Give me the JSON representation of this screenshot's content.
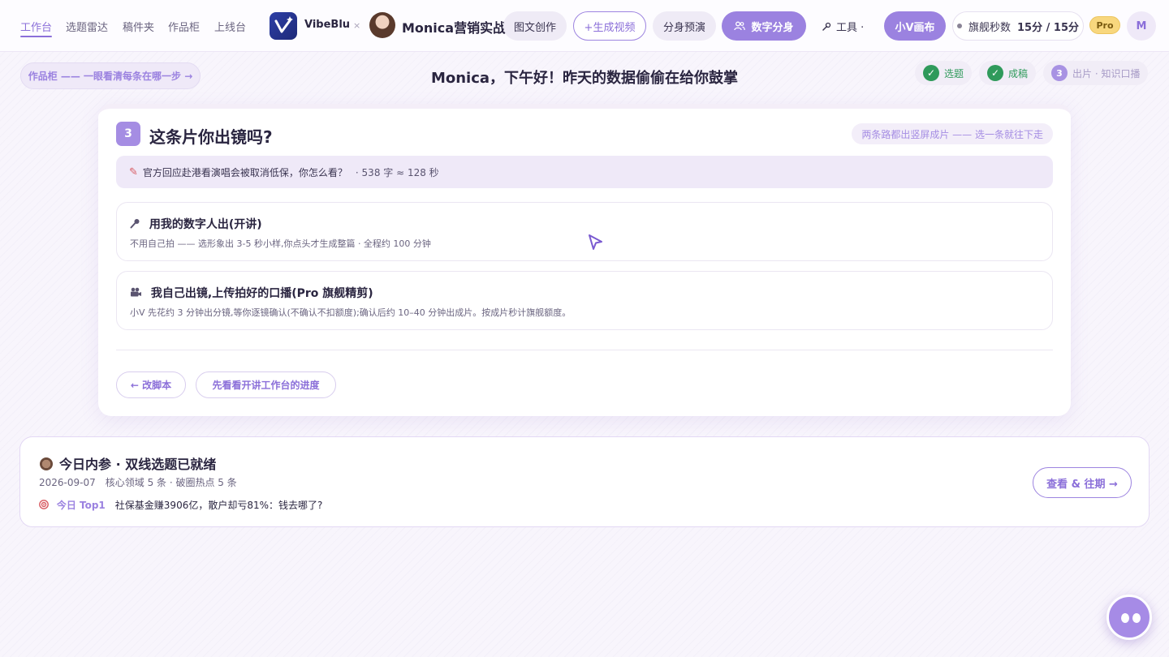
{
  "nav": {
    "links": [
      "工作台",
      "选题雷达",
      "稿件夹",
      "作品柜",
      "上线台"
    ],
    "brand": "VibeBlu",
    "separator": "×",
    "workspace": "Monica营销实战",
    "pills": {
      "image_text": "图文创作",
      "gen_video": "+生成视频",
      "preview": "分身预演",
      "digital_twin": "数字分身",
      "tools": "工具 ·",
      "canvas": "小V画布"
    },
    "credits": {
      "label": "旗舰秒数",
      "value": "15分 / 15分"
    },
    "pro": "Pro",
    "user_initial": "M"
  },
  "greeting": {
    "works_link": "作品柜 —— 一眼看清每条在哪一步 →",
    "text": "Monica，下午好！昨天的数据偷偷在给你鼓掌",
    "steps": [
      {
        "label": "选题",
        "mark": "✓"
      },
      {
        "label": "成稿",
        "mark": "✓"
      },
      {
        "label": "出片 · 知识口播",
        "mark": "3"
      }
    ]
  },
  "card": {
    "step": "3",
    "title": "这条片你出镜吗?",
    "hint": "两条路都出竖屏成片 —— 选一条就往下走",
    "script": {
      "title": "官方回应赴港看演唱会被取消低保，你怎么看？",
      "meta": "· 538 字 ≈ 128 秒"
    },
    "options": [
      {
        "icon": "microphone-icon",
        "title": "用我的数字人出(开讲)",
        "desc": "不用自己拍 —— 选形象出 3-5 秒小样,你点头才生成整篇 · 全程约 100 分钟"
      },
      {
        "icon": "camera-icon",
        "title": "我自己出镜,上传拍好的口播(Pro 旗舰精剪)",
        "desc": "小V 先花约 3 分钟出分镜,等你逐镜确认(不确认不扣额度);确认后约 10–40 分钟出成片。按成片秒计旗舰额度。"
      }
    ],
    "buttons": {
      "back": "← 改脚本",
      "progress": "先看看开讲工作台的进度"
    }
  },
  "brief": {
    "title": "今日内参 · 双线选题已就绪",
    "date": "2026-09-07",
    "meta": "核心领域 5 条 · 破圈热点 5 条",
    "top_label": "今日 Top1",
    "top_text": "社保基金赚3906亿，散户却亏81%：钱去哪了?",
    "view_button": "查看 & 往期 →"
  },
  "colors": {
    "accent": "#9b82e0",
    "success": "#2f9a5b",
    "pro": "#f8d77e"
  }
}
